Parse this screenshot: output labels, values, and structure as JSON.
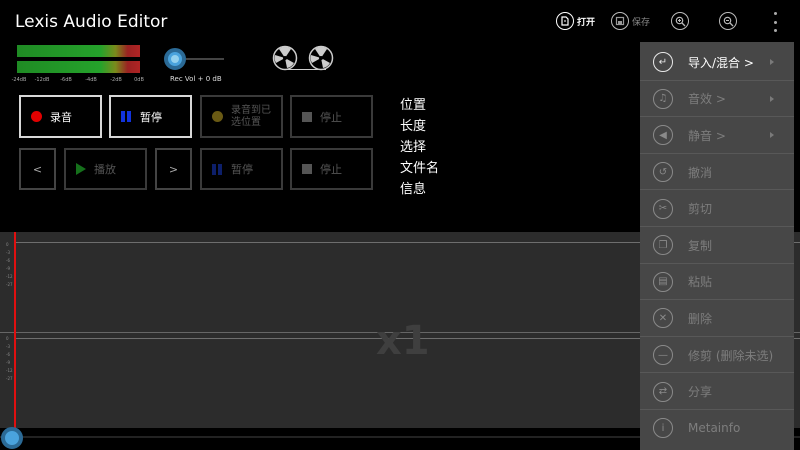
{
  "app": {
    "title": "Lexis Audio Editor"
  },
  "toolbar": {
    "open_label": "打开",
    "save_label": "保存",
    "zoom_in_icon": "zoom-in-icon",
    "zoom_out_icon": "zoom-out-icon",
    "overflow_icon": "more-vert-icon"
  },
  "meter": {
    "scale_labels": [
      "-24dB",
      "-12dB",
      "-6dB",
      "-4dB",
      "-2dB",
      "0dB"
    ]
  },
  "rec_volume": {
    "label": "Rec Vol + 0 dB",
    "value_db": 0
  },
  "buttons": {
    "record": "录音",
    "pause_record": "暂停",
    "record_to_position_line1": "录音到已",
    "record_to_position_line2": "选位置",
    "stop_record": "停止",
    "prev": "<",
    "play": "播放",
    "next": ">",
    "pause_play": "暂停",
    "stop_play": "停止"
  },
  "info": {
    "position": "位置",
    "length": "长度",
    "selection": "选择",
    "filename": "文件名",
    "details": "信息"
  },
  "waveform": {
    "zoom": "x1",
    "scale_labels": [
      "0",
      "-3",
      "-6",
      "-9",
      "-12",
      "-27"
    ]
  },
  "menu": {
    "items": [
      {
        "label": "导入/混合 >",
        "icon": "import-icon",
        "glyph": "↵",
        "enabled": true,
        "submenu": true
      },
      {
        "label": "音效 >",
        "icon": "music-note-icon",
        "glyph": "♫",
        "enabled": false,
        "submenu": true
      },
      {
        "label": "静音 >",
        "icon": "volume-mute-icon",
        "glyph": "◀",
        "enabled": false,
        "submenu": true
      },
      {
        "label": "撤消",
        "icon": "undo-icon",
        "glyph": "↺",
        "enabled": false,
        "submenu": false
      },
      {
        "label": "剪切",
        "icon": "scissors-icon",
        "glyph": "✂",
        "enabled": false,
        "submenu": false
      },
      {
        "label": "复制",
        "icon": "copy-icon",
        "glyph": "❐",
        "enabled": false,
        "submenu": false
      },
      {
        "label": "粘贴",
        "icon": "paste-icon",
        "glyph": "▤",
        "enabled": false,
        "submenu": false
      },
      {
        "label": "删除",
        "icon": "close-icon",
        "glyph": "✕",
        "enabled": false,
        "submenu": false
      },
      {
        "label": "修剪 (删除未选)",
        "icon": "trim-icon",
        "glyph": "—",
        "enabled": false,
        "submenu": false
      },
      {
        "label": "分享",
        "icon": "share-icon",
        "glyph": "⇄",
        "enabled": false,
        "submenu": false
      },
      {
        "label": "Metainfo",
        "icon": "info-icon",
        "glyph": "i",
        "enabled": false,
        "submenu": false
      }
    ]
  },
  "colors": {
    "background": "#000000",
    "menu_bg": "#474747",
    "waveform_bg": "#2c2c2c",
    "accent_blue": "#4aa3dd",
    "record_red": "#e10000",
    "play_green": "#15701b",
    "pause_blue": "#1133dd",
    "playhead_red": "#e01010"
  }
}
